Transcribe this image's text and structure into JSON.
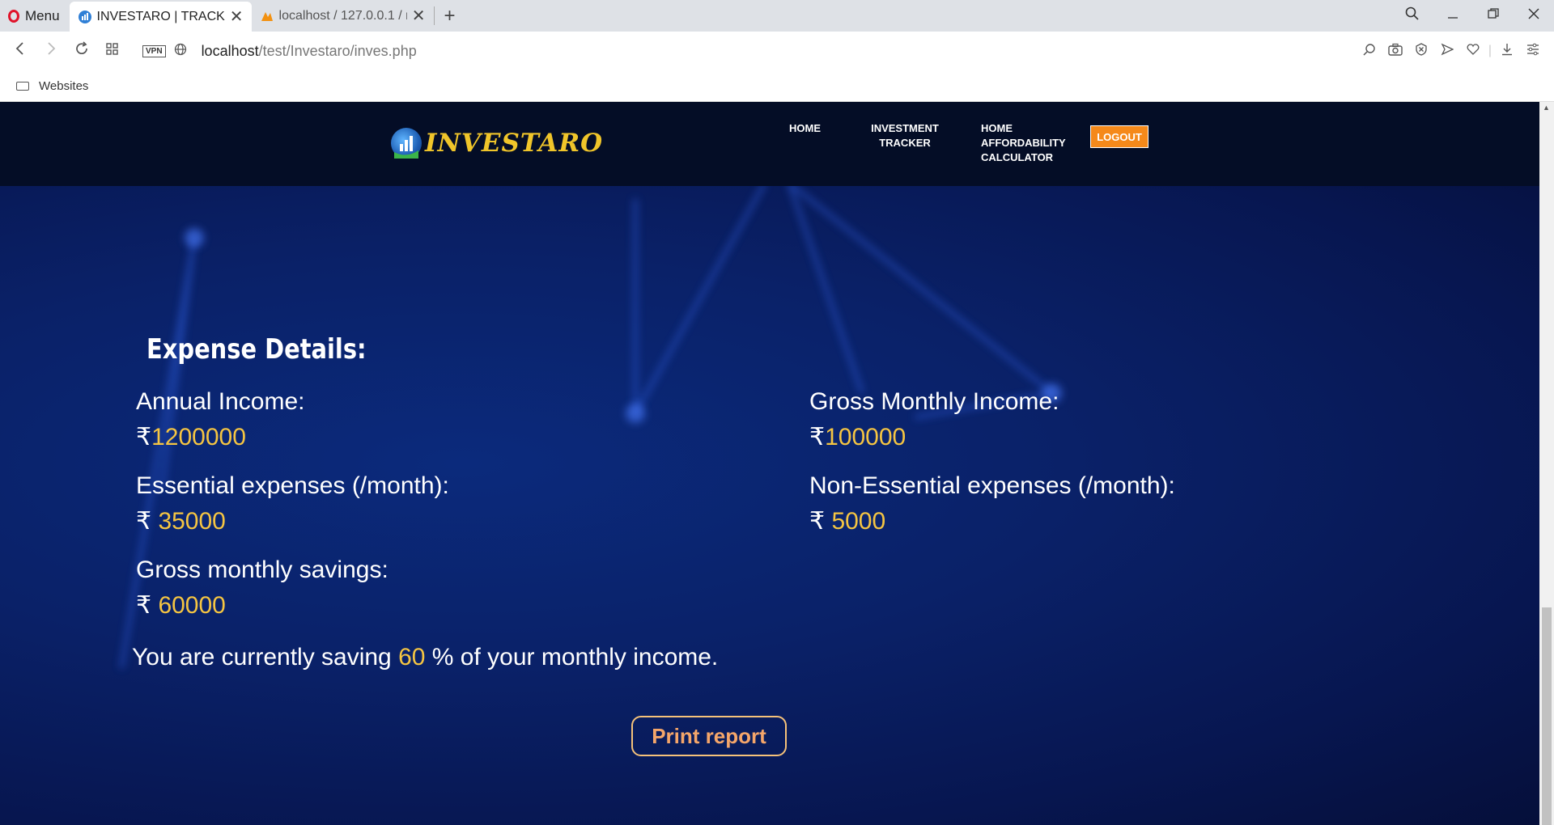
{
  "browser": {
    "menu_label": "Menu",
    "tabs": [
      {
        "label": "INVESTARO | TRACKER",
        "active": true
      },
      {
        "label": "localhost / 127.0.0.1 / regis",
        "active": false
      }
    ],
    "new_tab": "+",
    "url_host": "localhost",
    "url_path": "/test/Investaro/inves.php",
    "vpn_label": "VPN",
    "bookmark_folder": "Websites"
  },
  "header": {
    "logo_text": "INVESTARO",
    "nav": [
      {
        "label": "HOME"
      },
      {
        "label": "INVESTMENT TRACKER"
      },
      {
        "label": "HOME AFFORDABILITY CALCULATOR"
      }
    ],
    "logout_label": "LOGOUT"
  },
  "main": {
    "title": "Expense Details:",
    "currency": "₹",
    "annual_income_label": "Annual Income:",
    "annual_income_value": "1200000",
    "gross_monthly_label": "Gross Monthly Income:",
    "gross_monthly_value": "100000",
    "essential_label": "Essential expenses (/month):",
    "essential_value": "35000",
    "nonessential_label": "Non-Essential expenses (/month):",
    "nonessential_value": "5000",
    "savings_label": "Gross monthly savings:",
    "savings_value": "60000",
    "summary_prefix": "You are currently saving ",
    "summary_percent": "60",
    "summary_suffix": " % of your monthly income.",
    "print_label": "Print report"
  },
  "colors": {
    "accent_yellow": "#f5c542",
    "logout_orange": "#f5891a",
    "header_bg": "#040d26",
    "page_bg": "#0a2168"
  }
}
